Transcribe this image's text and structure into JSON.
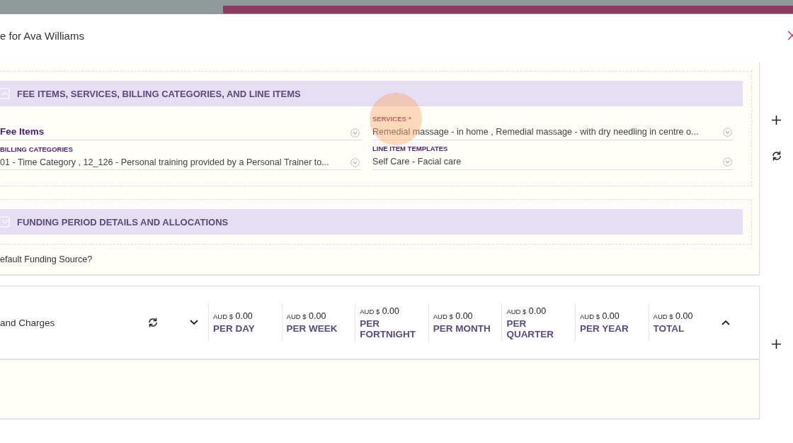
{
  "dialog": {
    "title": "e for Ava Williams"
  },
  "sections": [
    {
      "title": "FEE ITEMS, SERVICES, BILLING CATEGORIES, AND LINE ITEMS",
      "expanded": true,
      "field_rows": [
        {
          "fields": [
            {
              "placeholder": "Fee Items"
            },
            {
              "label": "SERVICES",
              "required_mark": "*",
              "value": "Remedial massage - in home , Remedial massage - with dry needling in centre o..."
            }
          ]
        },
        {
          "fields": [
            {
              "label": "BILLING CATEGORIES",
              "value": "01 - Time Category , 12_126 - Personal training provided by a Personal Trainer to..."
            },
            {
              "label": "LINE ITEM TEMPLATES",
              "value": "Self Care - Facial care"
            }
          ]
        }
      ]
    },
    {
      "title": "FUNDING PERIOD DETAILS AND ALLOCATIONS",
      "expanded": false
    }
  ],
  "funding_question": "efault Funding Source?",
  "charges": {
    "title": "and Charges",
    "totals": [
      {
        "currency": "AUD $",
        "amount": "0.00",
        "period": "PER DAY"
      },
      {
        "currency": "AUD $",
        "amount": "0.00",
        "period": "PER WEEK"
      },
      {
        "currency": "AUD $",
        "amount": "0.00",
        "period": "PER FORTNIGHT"
      },
      {
        "currency": "AUD $",
        "amount": "0.00",
        "period": "PER MONTH"
      },
      {
        "currency": "AUD $",
        "amount": "0.00",
        "period": "PER QUARTER"
      },
      {
        "currency": "AUD $",
        "amount": "0.00",
        "period": "PER YEAR"
      },
      {
        "currency": "AUD $",
        "amount": "0.00",
        "period": "TOTAL"
      }
    ]
  }
}
